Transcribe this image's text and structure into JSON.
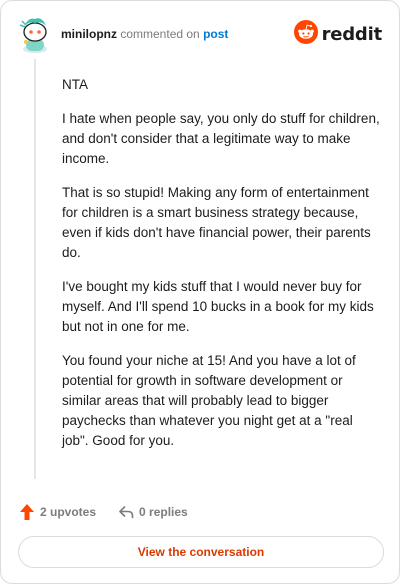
{
  "header": {
    "username": "minilopnz",
    "verb": "commented on",
    "post_link": "post",
    "brand": "reddit"
  },
  "comment": {
    "paragraphs": [
      "NTA",
      "I hate when people say, you only do stuff for children, and don't consider that a legitimate way to make income.",
      "That is so stupid! Making any form of entertainment for children is a smart business strategy because, even if kids don't have financial power, their parents do.",
      "I've bought my kids stuff that I would never buy for myself. And I'll spend 10 bucks in a book for my kids but not in one for me.",
      "You found your niche at 15! And you have a lot of potential for growth in software development or similar areas that will probably lead to bigger paychecks than whatever you night get at a \"real job\". Good for you."
    ]
  },
  "footer": {
    "upvotes": "2 upvotes",
    "replies": "0 replies",
    "view_conversation": "View the conversation"
  },
  "colors": {
    "accent": "#ff4500",
    "link": "#0079d3",
    "button_text": "#d93a00"
  },
  "icons": {
    "avatar": "snoo-avatar",
    "brand": "reddit-logo-icon",
    "upvote": "upvote-arrow-icon",
    "reply": "reply-arrow-icon"
  }
}
